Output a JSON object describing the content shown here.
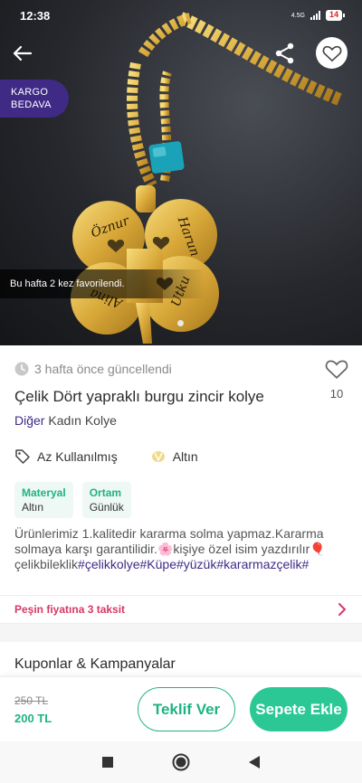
{
  "status_bar": {
    "time": "12:38",
    "network": "4.5G",
    "battery": "14"
  },
  "hero": {
    "badge_line1": "KARGO",
    "badge_line2": "BEDAVA",
    "favorites_note": "Bu hafta 2 kez favorilendi.",
    "engraved_names": [
      "Öznur",
      "Harun",
      "Utku",
      "Alina"
    ]
  },
  "product": {
    "updated": "3 hafta önce güncellendi",
    "like_count": "10",
    "title": "Çelik Dört yapraklı burgu zincir kolye",
    "category": "Diğer",
    "subcategory": "Kadın Kolye",
    "condition": "Az Kullanılmış",
    "color": "Altın",
    "attributes": [
      {
        "key": "Materyal",
        "value": "Altın"
      },
      {
        "key": "Ortam",
        "value": "Günlük"
      }
    ],
    "description_text": "Ürünlerimiz 1.kalitedir kararma solma yapmaz.Kararma solmaya karşı garantilidir.🌸kişiye özel isim yazdırılır🎈çelikbileklik",
    "hashtags": "#çelikkolye#Küpe#yüzük#kararmazçelik#"
  },
  "installment": {
    "label": "Peşin fiyatına 3 taksit"
  },
  "coupons": {
    "title": "Kuponlar & Kampanyalar"
  },
  "action_bar": {
    "old_price": "250 TL",
    "new_price": "200 TL",
    "offer_label": "Teklif Ver",
    "cart_label": "Sepete Ekle"
  },
  "colors": {
    "brand_purple": "#3f2b86",
    "green": "#1fb384",
    "pink": "#d63864"
  }
}
